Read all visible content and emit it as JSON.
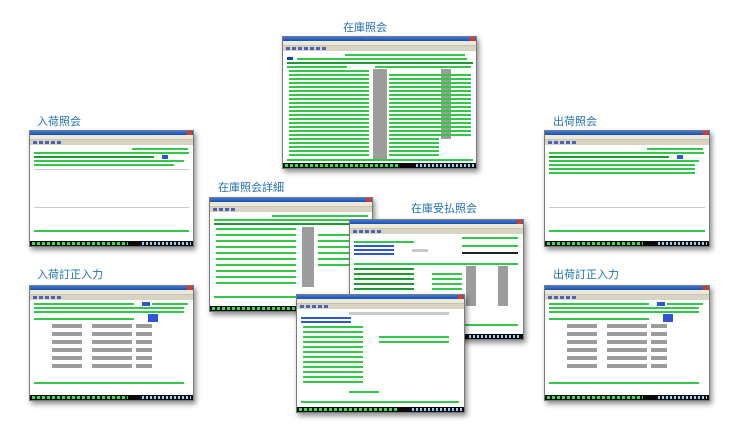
{
  "captions": {
    "zaiko_shokai": "在庫照会",
    "nyuka_shokai": "入荷照会",
    "shukka_shokai": "出荷照会",
    "zaiko_shokai_shosai": "在庫照会詳細",
    "zaiko_ukeharai_shokai": "在庫受払照会",
    "nyuka_teisei_nyuryoku": "入荷訂正入力",
    "shukka_teisei_nyuryoku": "出荷訂正入力"
  },
  "colors": {
    "caption": "#1f6fb2",
    "screen_text": "#32c84a",
    "status_bar": "#0a0a0a"
  }
}
